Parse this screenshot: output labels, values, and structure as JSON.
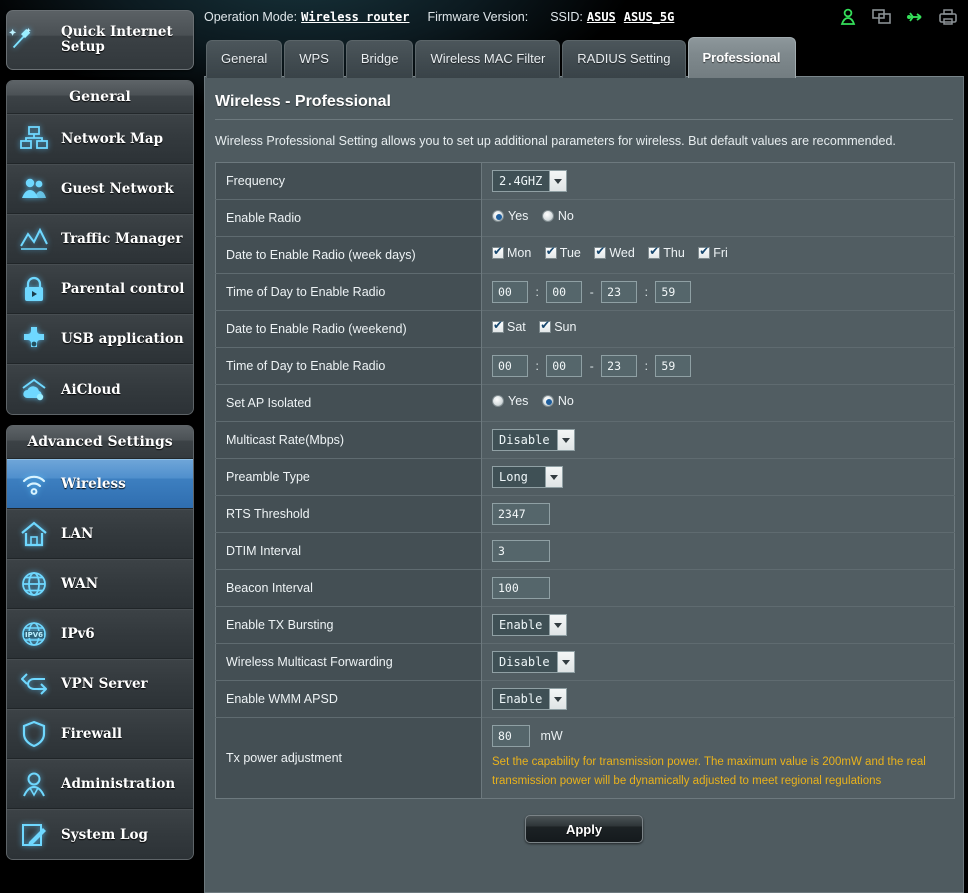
{
  "topbar": {
    "operation_mode_label": "Operation Mode:",
    "operation_mode_value": "Wireless router",
    "firmware_label": "Firmware Version:",
    "firmware_value": "",
    "ssid_label": "SSID:",
    "ssid_value_1": "ASUS",
    "ssid_value_2": "ASUS_5G",
    "icons": [
      "user-icon",
      "network-clients-icon",
      "usb-icon",
      "printer-icon"
    ]
  },
  "sidebar": {
    "quick_setup": {
      "label_line1": "Quick Internet",
      "label_line2": "Setup",
      "icon": "magic-wand-icon"
    },
    "general_header": "General",
    "general_items": [
      {
        "label": "Network Map",
        "icon": "network-map-icon",
        "active": false
      },
      {
        "label": "Guest Network",
        "icon": "guest-network-icon",
        "active": false
      },
      {
        "label": "Traffic Manager",
        "icon": "traffic-manager-icon",
        "active": false
      },
      {
        "label": "Parental control",
        "icon": "parental-control-icon",
        "active": false
      },
      {
        "label": "USB application",
        "icon": "usb-application-icon",
        "active": false
      },
      {
        "label": "AiCloud",
        "icon": "aicloud-icon",
        "active": false
      }
    ],
    "advanced_header": "Advanced Settings",
    "advanced_items": [
      {
        "label": "Wireless",
        "icon": "wireless-icon",
        "active": true
      },
      {
        "label": "LAN",
        "icon": "lan-icon",
        "active": false
      },
      {
        "label": "WAN",
        "icon": "wan-icon",
        "active": false
      },
      {
        "label": "IPv6",
        "icon": "ipv6-icon",
        "active": false
      },
      {
        "label": "VPN Server",
        "icon": "vpn-server-icon",
        "active": false
      },
      {
        "label": "Firewall",
        "icon": "firewall-icon",
        "active": false
      },
      {
        "label": "Administration",
        "icon": "administration-icon",
        "active": false
      },
      {
        "label": "System Log",
        "icon": "system-log-icon",
        "active": false
      }
    ]
  },
  "tabs": [
    {
      "label": "General",
      "active": false
    },
    {
      "label": "WPS",
      "active": false
    },
    {
      "label": "Bridge",
      "active": false
    },
    {
      "label": "Wireless MAC Filter",
      "active": false
    },
    {
      "label": "RADIUS Setting",
      "active": false
    },
    {
      "label": "Professional",
      "active": true
    }
  ],
  "panel": {
    "title": "Wireless - Professional",
    "description": "Wireless Professional Setting allows you to set up additional parameters for wireless. But default values are recommended."
  },
  "form": {
    "frequency": {
      "label": "Frequency",
      "value": "2.4GHZ"
    },
    "enable_radio": {
      "label": "Enable Radio",
      "yes": "Yes",
      "no": "No",
      "selected": "Yes"
    },
    "date_weekdays": {
      "label": "Date to Enable Radio (week days)",
      "days": [
        {
          "label": "Mon",
          "checked": true
        },
        {
          "label": "Tue",
          "checked": true
        },
        {
          "label": "Wed",
          "checked": true
        },
        {
          "label": "Thu",
          "checked": true
        },
        {
          "label": "Fri",
          "checked": true
        }
      ]
    },
    "time_weekdays": {
      "label": "Time of Day to Enable Radio",
      "start_hour": "00",
      "start_min": "00",
      "end_hour": "23",
      "end_min": "59",
      "colon": ":",
      "dash": "-"
    },
    "date_weekend": {
      "label": "Date to Enable Radio (weekend)",
      "days": [
        {
          "label": "Sat",
          "checked": true
        },
        {
          "label": "Sun",
          "checked": true
        }
      ]
    },
    "time_weekend": {
      "label": "Time of Day to Enable Radio",
      "start_hour": "00",
      "start_min": "00",
      "end_hour": "23",
      "end_min": "59",
      "colon": ":",
      "dash": "-"
    },
    "ap_isolated": {
      "label": "Set AP Isolated",
      "yes": "Yes",
      "no": "No",
      "selected": "No"
    },
    "multicast_rate": {
      "label": "Multicast Rate(Mbps)",
      "value": "Disable"
    },
    "preamble_type": {
      "label": "Preamble Type",
      "value": "Long"
    },
    "rts_threshold": {
      "label": "RTS Threshold",
      "value": "2347"
    },
    "dtim_interval": {
      "label": "DTIM Interval",
      "value": "3"
    },
    "beacon_interval": {
      "label": "Beacon Interval",
      "value": "100"
    },
    "tx_bursting": {
      "label": "Enable TX Bursting",
      "value": "Enable"
    },
    "multicast_forwarding": {
      "label": "Wireless Multicast Forwarding",
      "value": "Disable"
    },
    "wmm_apsd": {
      "label": "Enable WMM APSD",
      "value": "Enable"
    },
    "tx_power": {
      "label": "Tx power adjustment",
      "value": "80",
      "unit": "mW",
      "hint": "Set the capability for transmission power. The maximum value is 200mW and the real transmission power will be dynamically adjusted to meet regional regulations"
    }
  },
  "apply_button": "Apply"
}
